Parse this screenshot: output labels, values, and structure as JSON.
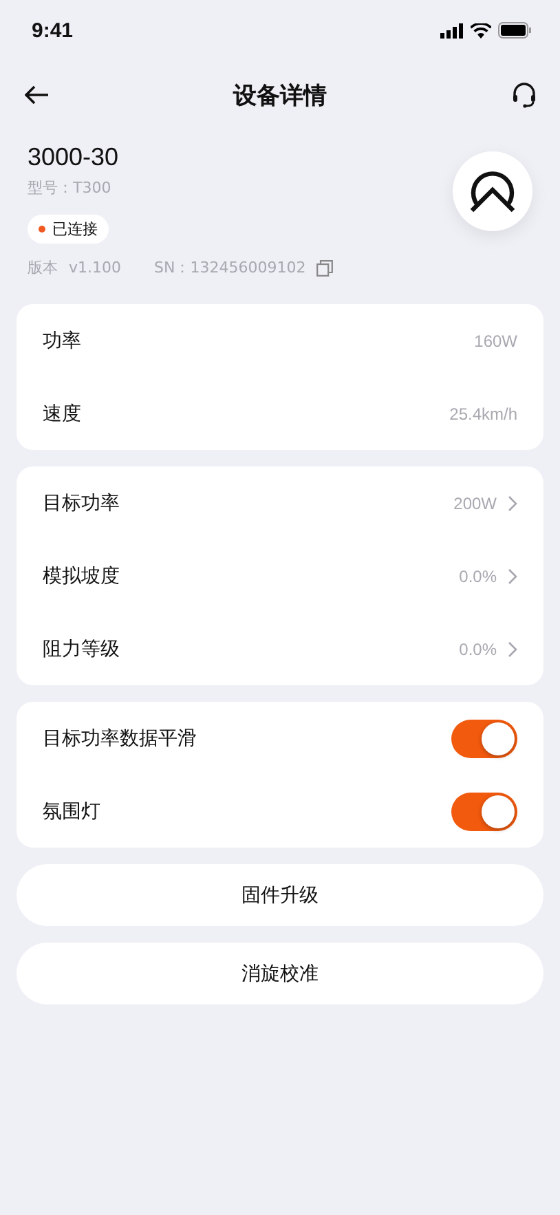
{
  "status_bar": {
    "time": "9:41"
  },
  "header": {
    "title": "设备详情"
  },
  "device": {
    "name": "3000-30",
    "model": "型号：T300",
    "status": "已连接",
    "version_label": "版本",
    "version": "v1.100",
    "sn": "SN：132456009102"
  },
  "groups": [
    {
      "rows": [
        {
          "kind": "info",
          "label": "功率",
          "value": "160W"
        },
        {
          "kind": "info",
          "label": "速度",
          "value": "25.4km/h"
        }
      ]
    },
    {
      "rows": [
        {
          "kind": "link",
          "label": "目标功率",
          "value": "200W"
        },
        {
          "kind": "link",
          "label": "模拟坡度",
          "value": "0.0%"
        },
        {
          "kind": "link",
          "label": "阻力等级",
          "value": "0.0%"
        }
      ]
    },
    {
      "rows": [
        {
          "kind": "toggle",
          "label": "目标功率数据平滑",
          "on": true
        },
        {
          "kind": "toggle",
          "label": "氛围灯",
          "on": true
        }
      ]
    }
  ],
  "buttons": [
    "固件升级",
    "消旋校准"
  ]
}
